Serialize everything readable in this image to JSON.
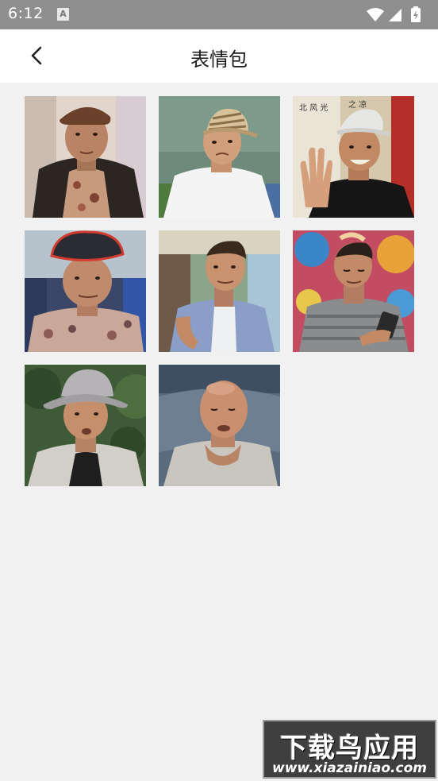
{
  "status_bar": {
    "time": "6:12",
    "notification_icon": "a-icon",
    "icons": [
      "wifi-icon",
      "signal-icon",
      "battery-charging-icon"
    ]
  },
  "app_bar": {
    "back_icon": "chevron-left-icon",
    "title": "表情包"
  },
  "stickers": [
    {
      "name": "sticker-1",
      "description": "man in brown flat cap, floral shirt",
      "bg": "#d7c9bd"
    },
    {
      "name": "sticker-2",
      "description": "man in striped straw hat, white t-shirt",
      "bg": "#6f8c7c"
    },
    {
      "name": "sticker-3",
      "description": "man in white cap waving hand",
      "bg": "#c9b79a"
    },
    {
      "name": "sticker-4",
      "description": "man in red-rimmed cap, patterned shirt",
      "bg": "#3a4a6e"
    },
    {
      "name": "sticker-5",
      "description": "man in blue shirt gesturing",
      "bg": "#7d9a7b"
    },
    {
      "name": "sticker-6",
      "description": "man in striped polo holding phone",
      "bg": "#c9586a"
    },
    {
      "name": "sticker-7",
      "description": "man in grey bucket hat outdoors",
      "bg": "#3f5a34"
    },
    {
      "name": "sticker-8",
      "description": "bald man lying on pillow",
      "bg": "#5a6c7d"
    }
  ],
  "watermark": {
    "main": "下载鸟应用",
    "sub": "www.xiazainiao.com"
  }
}
